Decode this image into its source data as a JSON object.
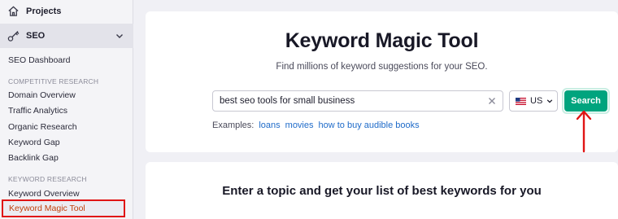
{
  "sidebar": {
    "projects_label": "Projects",
    "seo_label": "SEO",
    "items": [
      {
        "label": "SEO Dashboard"
      },
      {
        "section": "COMPETITIVE RESEARCH"
      },
      {
        "label": "Domain Overview"
      },
      {
        "label": "Traffic Analytics"
      },
      {
        "label": "Organic Research"
      },
      {
        "label": "Keyword Gap"
      },
      {
        "label": "Backlink Gap"
      },
      {
        "section": "KEYWORD RESEARCH"
      },
      {
        "label": "Keyword Overview"
      },
      {
        "label": "Keyword Magic Tool",
        "active": true
      }
    ]
  },
  "main": {
    "title": "Keyword Magic Tool",
    "subtitle": "Find millions of keyword suggestions for your SEO.",
    "search": {
      "value": "best seo tools for small business",
      "country": "US",
      "button_label": "Search"
    },
    "examples": {
      "label": "Examples:",
      "links": [
        "loans",
        "movies",
        "how to buy audible books"
      ]
    },
    "bottom_title": "Enter a topic and get your list of best keywords for you"
  },
  "colors": {
    "accent": "#00a47e",
    "link": "#1f6bc9",
    "highlight": "#e01515",
    "active_text": "#c2410c"
  },
  "icons": {
    "projects": "home-icon",
    "seo": "seo-key-icon",
    "clear": "close-icon",
    "flag": "us-flag-icon",
    "annotation": "red-arrow-icon"
  }
}
